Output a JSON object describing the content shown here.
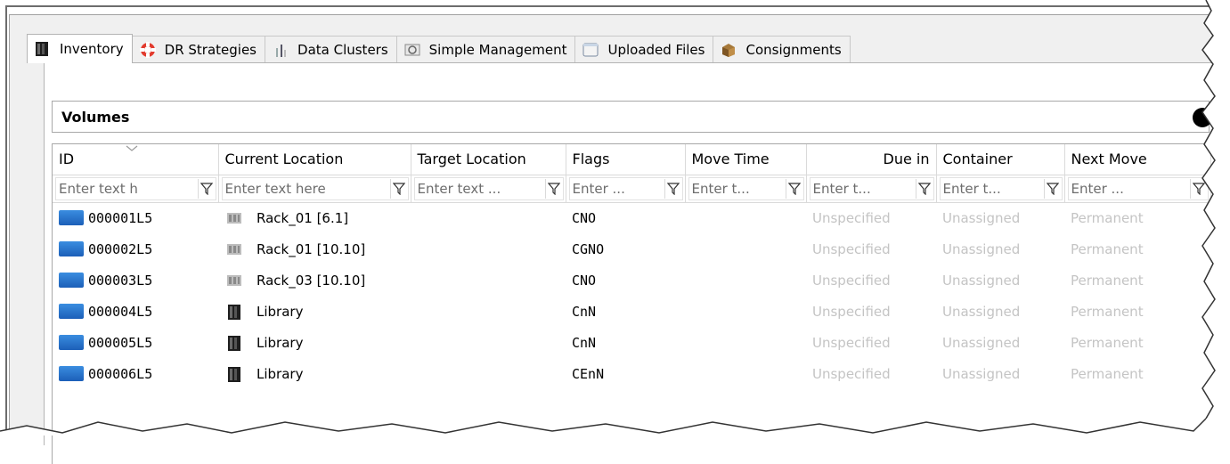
{
  "tabs": [
    {
      "label": "Inventory",
      "icon": "library-icon",
      "active": true
    },
    {
      "label": "DR Strategies",
      "icon": "lifebuoy-icon",
      "active": false
    },
    {
      "label": "Data Clusters",
      "icon": "cluster-icon",
      "active": false
    },
    {
      "label": "Simple Management",
      "icon": "management-icon",
      "active": false
    },
    {
      "label": "Uploaded Files",
      "icon": "window-icon",
      "active": false
    },
    {
      "label": "Consignments",
      "icon": "box-icon",
      "active": false
    }
  ],
  "section_title": "Volumes",
  "columns": [
    {
      "label": "ID",
      "placeholder": "Enter text h"
    },
    {
      "label": "Current Location",
      "placeholder": "Enter text here"
    },
    {
      "label": "Target Location",
      "placeholder": "Enter text ..."
    },
    {
      "label": "Flags",
      "placeholder": "Enter ..."
    },
    {
      "label": "Move Time",
      "placeholder": "Enter t..."
    },
    {
      "label": "Due in",
      "placeholder": "Enter t..."
    },
    {
      "label": "Container",
      "placeholder": "Enter t..."
    },
    {
      "label": "Next Move",
      "placeholder": "Enter ..."
    }
  ],
  "rows": [
    {
      "id": "000001L5",
      "location": "Rack_01 [6.1]",
      "location_icon": "rack-icon",
      "target": "",
      "flags": "CNO",
      "move_time": "",
      "due_in": "Unspecified",
      "container": "Unassigned",
      "next_move": "Permanent"
    },
    {
      "id": "000002L5",
      "location": "Rack_01 [10.10]",
      "location_icon": "rack-icon",
      "target": "",
      "flags": "CGNO",
      "move_time": "",
      "due_in": "Unspecified",
      "container": "Unassigned",
      "next_move": "Permanent"
    },
    {
      "id": "000003L5",
      "location": "Rack_03 [10.10]",
      "location_icon": "rack-icon",
      "target": "",
      "flags": "CNO",
      "move_time": "",
      "due_in": "Unspecified",
      "container": "Unassigned",
      "next_move": "Permanent"
    },
    {
      "id": "000004L5",
      "location": "Library",
      "location_icon": "library-icon",
      "target": "",
      "flags": "CnN",
      "move_time": "",
      "due_in": "Unspecified",
      "container": "Unassigned",
      "next_move": "Permanent"
    },
    {
      "id": "000005L5",
      "location": "Library",
      "location_icon": "library-icon",
      "target": "",
      "flags": "CnN",
      "move_time": "",
      "due_in": "Unspecified",
      "container": "Unassigned",
      "next_move": "Permanent"
    },
    {
      "id": "000006L5",
      "location": "Library",
      "location_icon": "library-icon",
      "target": "",
      "flags": "CEnN",
      "move_time": "",
      "due_in": "Unspecified",
      "container": "Unassigned",
      "next_move": "Permanent"
    }
  ]
}
